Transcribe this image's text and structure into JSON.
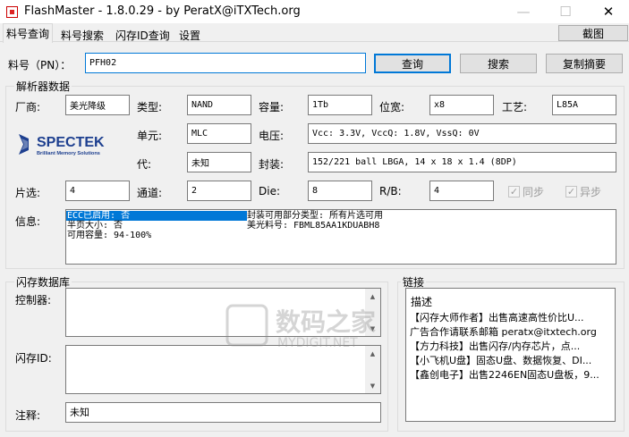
{
  "window": {
    "title": "FlashMaster - 1.8.0.29 - by PeratX@iTXTech.org",
    "minimize": "—",
    "maximize": "☐",
    "close": "✕"
  },
  "tabs": [
    "料号查询",
    "料号搜索",
    "闪存ID查询",
    "设置"
  ],
  "screenshot_button": "截图",
  "part_number": {
    "label": "料号（PN）：",
    "value": "PFH02"
  },
  "actions": {
    "query": "查询",
    "search": "搜索",
    "copy_summary": "复制摘要"
  },
  "parser": {
    "group_title": "解析器数据",
    "vendor_label": "厂商:",
    "vendor_value": "美光降级",
    "type_label": "类型:",
    "type_value": "NAND",
    "capacity_label": "容量:",
    "capacity_value": "1Tb",
    "width_label": "位宽:",
    "width_value": "x8",
    "process_label": "工艺:",
    "process_value": "L85A",
    "logo_text": "SPECTEK",
    "logo_tagline": "Brilliant Memory Solutions",
    "cell_label": "单元:",
    "cell_value": "MLC",
    "voltage_label": "电压:",
    "voltage_value": "Vcc: 3.3V, VccQ: 1.8V, VssQ: 0V",
    "gen_label": "代:",
    "gen_value": "未知",
    "package_label": "封装:",
    "package_value": "152/221 ball LBGA, 14 x 18 x 1.4 (8DP)",
    "ce_label": "片选:",
    "ce_value": "4",
    "channel_label": "通道:",
    "channel_value": "2",
    "die_label": "Die:",
    "die_value": "8",
    "rb_label": "R/B:",
    "rb_value": "4",
    "sync_label": "同步",
    "async_label": "异步",
    "info_label": "信息:",
    "info_lines": [
      {
        "left": "ECC已启用: 否",
        "right": "封装可用部分类型: 所有片选可用"
      },
      {
        "left": "半页大小: 否",
        "right": "美光料号: FBML85AA1KDUABH8"
      },
      {
        "left": "可用容量: 94-100%",
        "right": ""
      }
    ]
  },
  "flashdb": {
    "group_title": "闪存数据库",
    "controller_label": "控制器:",
    "flash_id_label": "闪存ID:",
    "note_label": "注释:",
    "note_value": "未知"
  },
  "links": {
    "group_title": "链接",
    "header": "描述",
    "items": [
      "【闪存大师作者】出售高速高性价比U...",
      "广告合作请联系邮箱 peratx@itxtech.org",
      "【方力科技】出售闪存/内存芯片，点...",
      "【小飞机U盘】固态U盘、数据恢复、DI...",
      "【鑫创电子】出售2246EN固态U盘板，9..."
    ]
  },
  "watermark": {
    "text": "数码之家",
    "sub": "MYDIGIT.NET"
  },
  "colors": {
    "selection": "#0078d7",
    "spectek_blue": "#1d3f8f",
    "focus_border": "#0078d7"
  }
}
